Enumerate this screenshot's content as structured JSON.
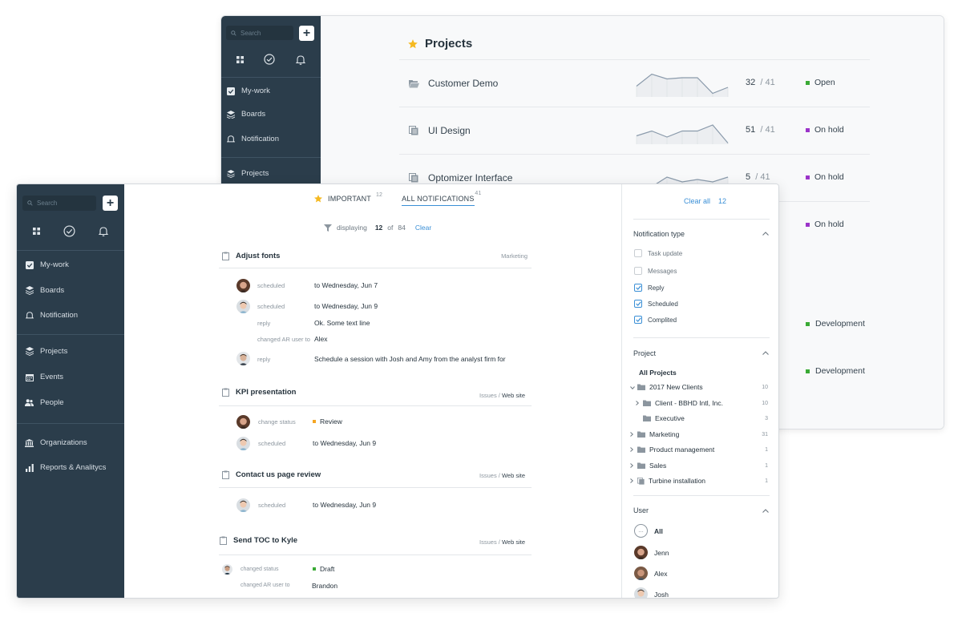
{
  "back": {
    "sidebar": {
      "search_placeholder": "Search",
      "plus_label": "+",
      "items": [
        {
          "label": "My-work",
          "icon": "checkbox-icon"
        },
        {
          "label": "Boards",
          "icon": "layers-icon"
        },
        {
          "label": "Notification",
          "icon": "bell-icon"
        },
        {
          "label": "Projects",
          "icon": "layers-icon"
        }
      ]
    },
    "title": "Projects",
    "projects": [
      {
        "name": "Customer Demo",
        "icon": "folder-open-icon",
        "count": "32",
        "total": "/ 41",
        "status": "Open",
        "status_color": "#3aaa35",
        "spark": [
          0.45,
          0.95,
          0.75,
          0.8,
          0.8,
          0.15,
          0.4
        ]
      },
      {
        "name": "UI Design",
        "icon": "copy-icon",
        "count": "51",
        "total": "/ 41",
        "status": "On hold",
        "status_color": "#9b34c9",
        "spark": [
          0.35,
          0.55,
          0.3,
          0.55,
          0.55,
          0.8,
          0.05
        ]
      },
      {
        "name": "Optomizer Interface",
        "icon": "copy-icon",
        "count": "5",
        "total": "/ 41",
        "status": "On hold",
        "status_color": "#9b34c9",
        "spark": [
          0.1,
          0.2,
          0.6,
          0.4,
          0.5,
          0.4,
          0.6
        ]
      },
      {
        "status": "On hold",
        "status_color": "#9b34c9"
      }
    ],
    "dev_statuses": [
      {
        "label": "Development",
        "color": "#3aaa35"
      },
      {
        "label": "Development",
        "color": "#3aaa35"
      }
    ]
  },
  "front": {
    "sidebar": {
      "search_placeholder": "Search",
      "plus_label": "+",
      "items_top": [
        {
          "label": "My-work"
        },
        {
          "label": "Boards"
        },
        {
          "label": "Notification"
        }
      ],
      "items_mid": [
        {
          "label": "Projects"
        },
        {
          "label": "Events"
        },
        {
          "label": "People"
        }
      ],
      "items_bottom": [
        {
          "label": "Organizations"
        },
        {
          "label": "Reports & Analitycs"
        }
      ]
    },
    "tabs": {
      "important": {
        "label": "IMPORTANT",
        "count": "12"
      },
      "all": {
        "label": "ALL NOTIFICATIONS",
        "count": "41"
      }
    },
    "filter": {
      "displaying": "displaying",
      "shown": "12",
      "of": "of",
      "total": "84",
      "clear": "Clear"
    },
    "groups": [
      {
        "title": "Adjust fonts",
        "tag": "Marketing",
        "tag_link": "",
        "activities": [
          {
            "label": "scheduled",
            "value": "to Wednesday, Jun 7"
          },
          {
            "label": "scheduled",
            "value": "to Wednesday, Jun 9"
          },
          {
            "label": "reply",
            "value": "Ok. Some text line"
          },
          {
            "label": "changed AR user to",
            "value": "Alex"
          },
          {
            "label": "reply",
            "value": "Schedule a session with Josh and Amy from the analyst firm for"
          }
        ]
      },
      {
        "title": "KPI presentation",
        "tag": "Issues /",
        "tag_link": "Web site",
        "activities": [
          {
            "label": "change status",
            "value": "Review",
            "color": "#f5a623"
          },
          {
            "label": "scheduled",
            "value": "to Wednesday, Jun 9"
          }
        ]
      },
      {
        "title": "Contact us page review",
        "tag": "Issues /",
        "tag_link": "Web site",
        "activities": [
          {
            "label": "scheduled",
            "value": "to Wednesday, Jun 9"
          }
        ]
      },
      {
        "title": "Send TOC to Kyle",
        "tag": "Issues /",
        "tag_link": "Web site",
        "activities": [
          {
            "label": "changed status",
            "value": "Draft",
            "color": "#3aaa35"
          },
          {
            "label": "changed AR user to",
            "value": "Brandon"
          }
        ]
      }
    ],
    "panel": {
      "clear_all": "Clear all",
      "clear_count": "12",
      "notification_type": {
        "title": "Notification type",
        "options": [
          {
            "label": "Task update",
            "checked": false
          },
          {
            "label": "Messages",
            "checked": false
          },
          {
            "label": "Reply",
            "checked": true
          },
          {
            "label": "Scheduled",
            "checked": true
          },
          {
            "label": "Complited",
            "checked": true
          }
        ]
      },
      "project": {
        "title": "Project",
        "all": "All Projects",
        "tree": [
          {
            "label": "2017 New Clients",
            "count": "10",
            "chev": "˅",
            "indent": 0
          },
          {
            "label": "Client - BBHD Intl, Inc.",
            "count": "10",
            "chev": "›",
            "indent": 1
          },
          {
            "label": "Executive",
            "count": "3",
            "chev": "",
            "indent": 1
          },
          {
            "label": "Marketing",
            "count": "31",
            "chev": "›",
            "indent": 0
          },
          {
            "label": "Product management",
            "count": "1",
            "chev": "›",
            "indent": 0
          },
          {
            "label": "Sales",
            "count": "1",
            "chev": "›",
            "indent": 0
          },
          {
            "label": "Turbine installation",
            "count": "1",
            "chev": "›",
            "indent": 0
          }
        ]
      },
      "user": {
        "title": "User",
        "users": [
          {
            "label": "All",
            "avatar": "all"
          },
          {
            "label": "Jenn",
            "avatar": "jenn"
          },
          {
            "label": "Alex",
            "avatar": "alex"
          },
          {
            "label": "Josh",
            "avatar": "josh"
          }
        ]
      }
    }
  }
}
